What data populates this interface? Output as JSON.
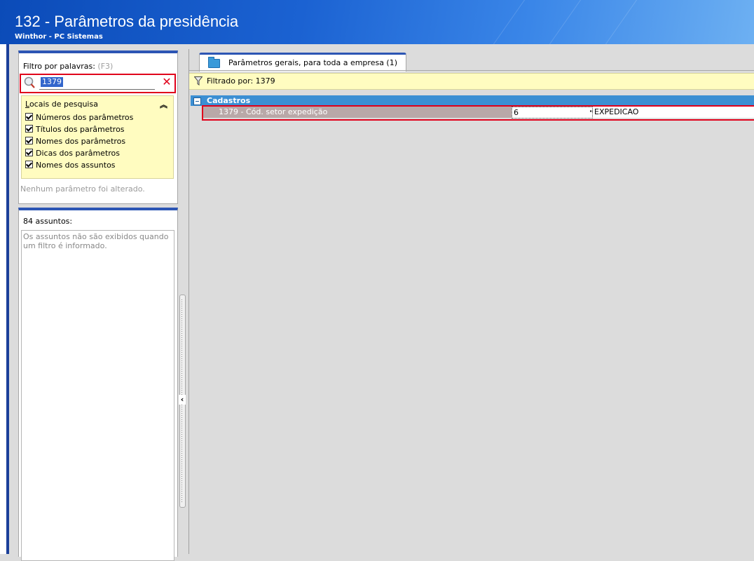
{
  "window": {
    "title": "132 - Parâmetros da presidência",
    "subtitle": "Winthor - PC Sistemas"
  },
  "filter": {
    "label": "Filtro por palavras:",
    "shortcut": "(F3)",
    "search_value": "1379",
    "locais": {
      "header_underlined": "L",
      "header_rest": "ocais de pesquisa",
      "options": [
        {
          "label": "Números dos parâmetros",
          "checked": true
        },
        {
          "label": "Títulos dos parâmetros",
          "checked": true
        },
        {
          "label": "Nomes dos parâmetros",
          "checked": true
        },
        {
          "label": "Dicas dos parâmetros",
          "checked": true
        },
        {
          "label": "Nomes dos assuntos",
          "checked": true
        }
      ]
    },
    "status": "Nenhum parâmetro foi alterado."
  },
  "topics": {
    "count_label": "84 assuntos:",
    "note": "Os assuntos não são exibidos quando um filtro é informado."
  },
  "tab": {
    "label": "Parâmetros gerais, para toda a empresa  (1)"
  },
  "filter_bar": {
    "text": "Filtrado por: 1379"
  },
  "grid": {
    "group": "Cadastros",
    "rows": [
      {
        "name": "1379 - Cód. setor expedição",
        "value": "6",
        "description": "EXPEDICAO"
      }
    ]
  },
  "colors": {
    "accent": "#2c55b4",
    "highlight": "#e0001b",
    "group_row": "#3b8fd3",
    "info_bar": "#fffcc0"
  }
}
